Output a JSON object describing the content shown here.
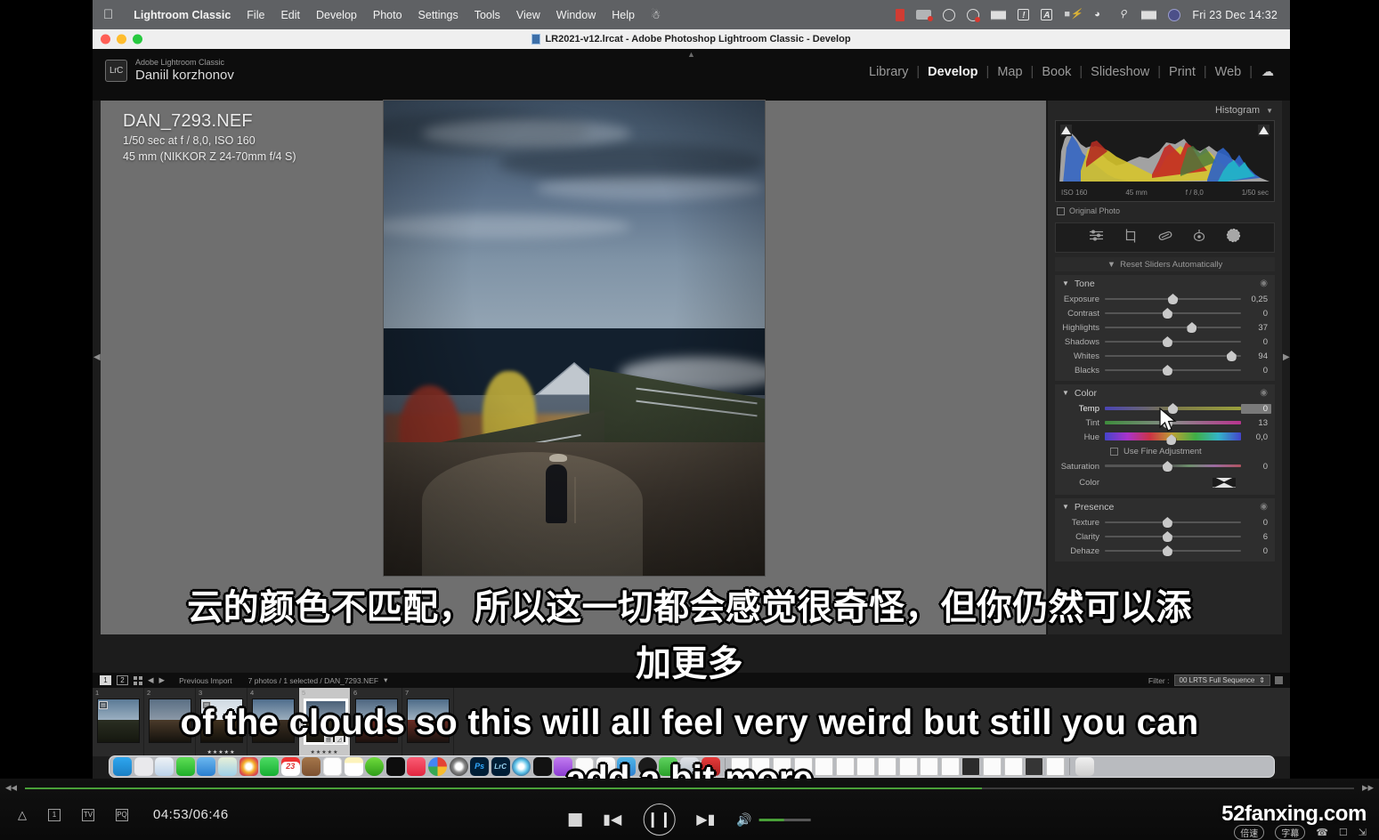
{
  "menubar": {
    "apple_icon": "apple-logo",
    "items": [
      "Lightroom Classic",
      "File",
      "Edit",
      "Develop",
      "Photo",
      "Settings",
      "Tools",
      "View",
      "Window",
      "Help"
    ],
    "status_icons": [
      "record-indicator-icon",
      "screen-recording-icon",
      "globe-icon",
      "do-not-disturb-icon",
      "stacks-icon",
      "alert-icon",
      "input-source-icon",
      "battery-icon",
      "wifi-icon",
      "search-icon",
      "airdrop-icon",
      "control-center-icon"
    ],
    "clock": "Fri 23 Dec  14:32"
  },
  "window": {
    "title": "LR2021-v12.lrcat - Adobe Photoshop Lightroom Classic - Develop",
    "traffic_lights": [
      "close-button",
      "minimize-button",
      "zoom-button"
    ]
  },
  "lightroom": {
    "identity": {
      "badge": "LrC",
      "product": "Adobe Lightroom Classic",
      "user": "Daniil korzhonov"
    },
    "modules": [
      {
        "label": "Library",
        "active": false
      },
      {
        "label": "Develop",
        "active": true
      },
      {
        "label": "Map",
        "active": false
      },
      {
        "label": "Book",
        "active": false
      },
      {
        "label": "Slideshow",
        "active": false
      },
      {
        "label": "Print",
        "active": false
      },
      {
        "label": "Web",
        "active": false
      }
    ],
    "cloud_icon": "cloud-sync-icon",
    "photo_info": {
      "filename": "DAN_7293.NEF",
      "exposure": "1/50 sec at f / 8,0, ISO 160",
      "lens": "45 mm (NIKKOR Z 24-70mm f/4 S)"
    },
    "right_panel": {
      "histogram": {
        "title": "Histogram",
        "collapse_icon": "chevron-down-icon",
        "meta": [
          "ISO 160",
          "45 mm",
          "f / 8,0",
          "1/50 sec"
        ],
        "original_photo_label": "Original Photo",
        "clip_left_icon": "shadow-clipping-icon",
        "clip_right_icon": "highlight-clipping-icon"
      },
      "tools": [
        "masking-icon",
        "crop-icon",
        "healing-brush-icon",
        "red-eye-icon",
        "radial-gradient-icon"
      ],
      "reset_row": {
        "label": "Reset Sliders Automatically",
        "tri_icon": "chevron-down-icon"
      },
      "sections": [
        {
          "name": "Tone",
          "eye_icon": "visibility-icon",
          "sliders": [
            {
              "label": "Exposure",
              "value": "0,25",
              "pos": 50,
              "active": false,
              "grad": ""
            },
            {
              "label": "Contrast",
              "value": "0",
              "pos": 46,
              "active": false,
              "grad": ""
            },
            {
              "label": "Highlights",
              "value": "37",
              "pos": 64,
              "active": false,
              "grad": ""
            },
            {
              "label": "Shadows",
              "value": "0",
              "pos": 46,
              "active": false,
              "grad": ""
            },
            {
              "label": "Whites",
              "value": "94",
              "pos": 93,
              "active": false,
              "grad": ""
            },
            {
              "label": "Blacks",
              "value": "0",
              "pos": 46,
              "active": false,
              "grad": ""
            }
          ]
        },
        {
          "name": "Color",
          "eye_icon": "visibility-icon",
          "sliders": [
            {
              "label": "Temp",
              "value": "0",
              "pos": 50,
              "active": true,
              "grad": "grad-temp"
            },
            {
              "label": "Tint",
              "value": "13",
              "pos": 46,
              "active": false,
              "grad": "grad-tint"
            },
            {
              "label": "Hue",
              "value": "0,0",
              "pos": 49,
              "active": false,
              "grad": "grad-hue"
            }
          ],
          "fine_adjust": {
            "label": "Use Fine Adjustment",
            "checked": false
          },
          "sliders2": [
            {
              "label": "Saturation",
              "value": "0",
              "pos": 46,
              "active": false,
              "grad": "grad-sat"
            }
          ],
          "color_row": {
            "label": "Color",
            "swatch": "color-swatch"
          }
        },
        {
          "name": "Presence",
          "eye_icon": "visibility-icon",
          "sliders": [
            {
              "label": "Texture",
              "value": "0",
              "pos": 46,
              "active": false,
              "grad": ""
            },
            {
              "label": "Clarity",
              "value": "6",
              "pos": 46,
              "active": false,
              "grad": ""
            },
            {
              "label": "Dehaze",
              "value": "0",
              "pos": 46,
              "active": false,
              "grad": ""
            }
          ]
        }
      ]
    },
    "filmstrip_bar": {
      "page1": "1",
      "page2": "2",
      "grid_icon": "grid-view-icon",
      "back_icon": "back-arrow-icon",
      "forward_icon": "forward-arrow-icon",
      "source": "Previous Import",
      "counts": "7 photos / 1 selected / DAN_7293.NEF",
      "dropdown_icon": "chevron-down-icon",
      "filter_label": "Filter :",
      "filter_value": "00 LRTS Full Sequence"
    },
    "thumbnails": [
      {
        "n": "1",
        "selected": false,
        "stars": "",
        "badge": "crop-badge"
      },
      {
        "n": "2",
        "selected": false,
        "stars": "",
        "badge": ""
      },
      {
        "n": "3",
        "selected": false,
        "stars": "★★★★★",
        "badge": "crop-badge"
      },
      {
        "n": "4",
        "selected": false,
        "stars": "",
        "badge": ""
      },
      {
        "n": "5",
        "selected": true,
        "stars": "★★★★★",
        "badge": ""
      },
      {
        "n": "6",
        "selected": false,
        "stars": "",
        "badge": ""
      },
      {
        "n": "7",
        "selected": false,
        "stars": "",
        "badge": ""
      }
    ]
  },
  "dock": {
    "apps": [
      "finder-icon",
      "launchpad-icon",
      "safari-icon",
      "messages-icon",
      "mail-icon",
      "maps-icon",
      "photos-icon",
      "facetime-icon",
      "calendar-icon",
      "contacts-icon",
      "reminders-icon",
      "notes-icon",
      "utorrent-icon",
      "appletv-icon",
      "music-icon",
      "chrome-icon",
      "settings-icon",
      "photoshop-icon",
      "lightroom-classic-icon",
      "capture-one-icon",
      "terminal-icon",
      "podcasts-icon",
      "tv-app-icon",
      "numbers-icon",
      "keynote-icon",
      "appstore-icon",
      "clock-icon",
      "calculator-icon",
      "preview-icon",
      "trash-icon"
    ]
  },
  "subtitles": {
    "chinese": "云的颜色不匹配，所以这一切都会感觉很奇怪，但你仍然可以添",
    "chinese_line2": "加更多",
    "english": "of the clouds so this will all feel very weird but still you can",
    "english_line2": "add a bit more"
  },
  "player": {
    "rewind_icon": "rewind-icon",
    "fastforward_icon": "fast-forward-icon",
    "progress_percent": 72,
    "left_icons": [
      "eject-icon",
      "chapter-1-icon",
      "tv-out-icon",
      "pip-icon"
    ],
    "time": "04:53/06:46",
    "stop_icon": "stop-icon",
    "prev_icon": "previous-track-icon",
    "play_pause_icon": "pause-icon",
    "next_icon": "next-track-icon",
    "volume_icon": "volume-icon",
    "volume_percent": 48,
    "watermark": "52fanxing.com",
    "speed_button": "倍速",
    "subtitle_button": "字幕",
    "mic_icon": "phone-icon",
    "cast_icon": "cast-icon",
    "fullscreen_icon": "fullscreen-icon"
  }
}
